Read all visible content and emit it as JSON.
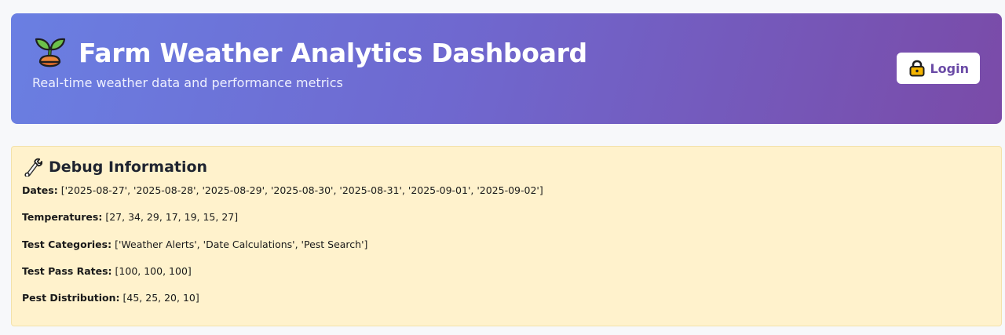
{
  "header": {
    "logo_icon": "seedling-icon",
    "title": "Farm Weather Analytics Dashboard",
    "subtitle": "Real-time weather data and performance metrics",
    "gradient_colors": [
      "#6a7fe2",
      "#7a4ba8"
    ]
  },
  "login": {
    "icon": "lock-icon",
    "label": "Login",
    "text_color": "#6a4aa6"
  },
  "debug": {
    "icon": "wrench-icon",
    "title": "Debug Information",
    "background_color": "#fff2cc",
    "lines": [
      {
        "label": "Dates:",
        "value": "['2025-08-27', '2025-08-28', '2025-08-29', '2025-08-30', '2025-08-31', '2025-09-01', '2025-09-02']"
      },
      {
        "label": "Temperatures:",
        "value": "[27, 34, 29, 17, 19, 15, 27]"
      },
      {
        "label": "Test Categories:",
        "value": "['Weather Alerts', 'Date Calculations', 'Pest Search']"
      },
      {
        "label": "Test Pass Rates:",
        "value": "[100, 100, 100]"
      },
      {
        "label": "Pest Distribution:",
        "value": "[45, 25, 20, 10]"
      }
    ]
  }
}
